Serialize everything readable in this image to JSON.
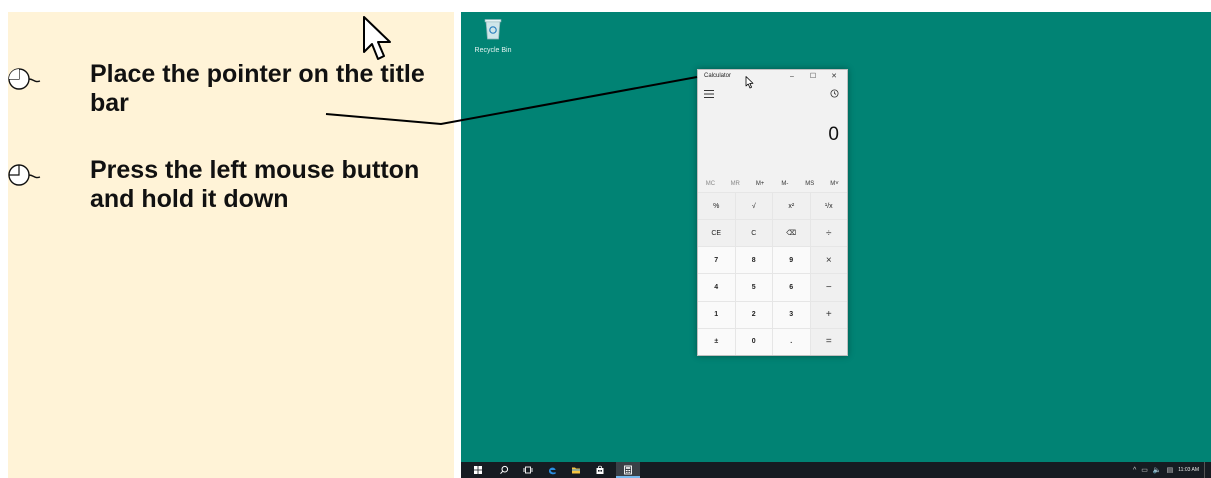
{
  "instructions": {
    "steps": [
      {
        "text": "Place the pointer on the title bar"
      },
      {
        "text": "Press the left mouse button and hold it down"
      }
    ],
    "icon": "mouse-left-click-icon"
  },
  "desktop": {
    "background_color": "#018374",
    "recycle_bin_label": "Recycle Bin"
  },
  "calculator": {
    "title": "Calculator",
    "minimize": "–",
    "maximize": "☐",
    "close": "✕",
    "display_value": "0",
    "memory_buttons": [
      "MC",
      "MR",
      "M+",
      "M-",
      "MS",
      "M˅"
    ],
    "keys": [
      {
        "label": "%",
        "kind": "fn"
      },
      {
        "label": "√",
        "kind": "fn"
      },
      {
        "label": "x²",
        "kind": "fn"
      },
      {
        "label": "¹/x",
        "kind": "fn"
      },
      {
        "label": "CE",
        "kind": "fn"
      },
      {
        "label": "C",
        "kind": "fn"
      },
      {
        "label": "⌫",
        "kind": "fn"
      },
      {
        "label": "÷",
        "kind": "op"
      },
      {
        "label": "7",
        "kind": "num"
      },
      {
        "label": "8",
        "kind": "num"
      },
      {
        "label": "9",
        "kind": "num"
      },
      {
        "label": "×",
        "kind": "op"
      },
      {
        "label": "4",
        "kind": "num"
      },
      {
        "label": "5",
        "kind": "num"
      },
      {
        "label": "6",
        "kind": "num"
      },
      {
        "label": "−",
        "kind": "op"
      },
      {
        "label": "1",
        "kind": "num"
      },
      {
        "label": "2",
        "kind": "num"
      },
      {
        "label": "3",
        "kind": "num"
      },
      {
        "label": "+",
        "kind": "op"
      },
      {
        "label": "±",
        "kind": "num"
      },
      {
        "label": "0",
        "kind": "num"
      },
      {
        "label": ".",
        "kind": "num"
      },
      {
        "label": "=",
        "kind": "op"
      }
    ]
  },
  "taskbar": {
    "icons": [
      "start-icon",
      "search-icon",
      "task-view-icon",
      "edge-icon",
      "file-explorer-icon",
      "store-icon",
      "calculator-app-icon"
    ],
    "tray_glyphs": [
      "^",
      "▭",
      "🔈",
      "▤"
    ],
    "clock_time": "11:03 AM"
  }
}
